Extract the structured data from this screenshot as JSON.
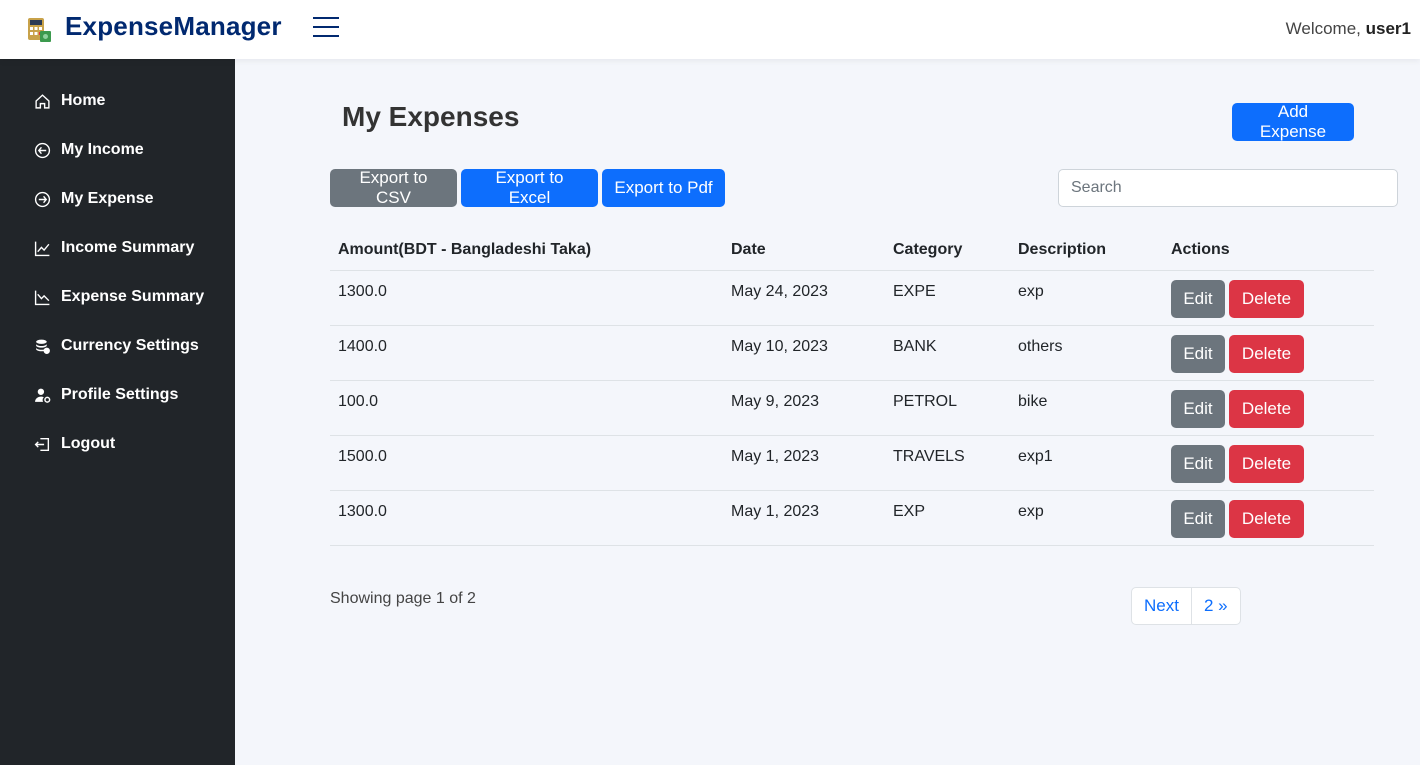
{
  "header": {
    "brand": "ExpenseManager",
    "welcome_prefix": "Welcome, ",
    "username": "user1"
  },
  "sidebar": {
    "items": [
      {
        "label": "Home",
        "icon": "home-icon"
      },
      {
        "label": "My Income",
        "icon": "arrow-left-circle-icon"
      },
      {
        "label": "My Expense",
        "icon": "arrow-right-circle-icon"
      },
      {
        "label": "Income Summary",
        "icon": "graph-up-icon"
      },
      {
        "label": "Expense Summary",
        "icon": "graph-down-icon"
      },
      {
        "label": "Currency Settings",
        "icon": "coins-icon"
      },
      {
        "label": "Profile Settings",
        "icon": "user-gear-icon"
      },
      {
        "label": "Logout",
        "icon": "logout-icon"
      }
    ]
  },
  "main": {
    "title": "My Expenses",
    "add_button": "Add Expense",
    "export": {
      "csv": "Export to CSV",
      "excel": "Export to Excel",
      "pdf": "Export to Pdf"
    },
    "search": {
      "placeholder": "Search",
      "value": ""
    },
    "table": {
      "headers": [
        "Amount(BDT - Bangladeshi Taka)",
        "Date",
        "Category",
        "Description",
        "Actions"
      ],
      "rows": [
        {
          "amount": "1300.0",
          "date": "May 24, 2023",
          "category": "EXPE",
          "description": "exp"
        },
        {
          "amount": "1400.0",
          "date": "May 10, 2023",
          "category": "BANK",
          "description": "others"
        },
        {
          "amount": "100.0",
          "date": "May 9, 2023",
          "category": "PETROL",
          "description": "bike"
        },
        {
          "amount": "1500.0",
          "date": "May 1, 2023",
          "category": "TRAVELS",
          "description": "exp1"
        },
        {
          "amount": "1300.0",
          "date": "May 1, 2023",
          "category": "EXP",
          "description": "exp"
        }
      ],
      "edit_label": "Edit",
      "delete_label": "Delete"
    },
    "pagination": {
      "showing": "Showing page 1 of 2",
      "next": "Next",
      "page2": "2 »"
    }
  },
  "colors": {
    "sidebar_bg": "#212529",
    "brand": "#012970",
    "primary": "#0d6efd",
    "secondary": "#6c757d",
    "danger": "#dc3545",
    "content_bg": "#f4f6fb"
  }
}
